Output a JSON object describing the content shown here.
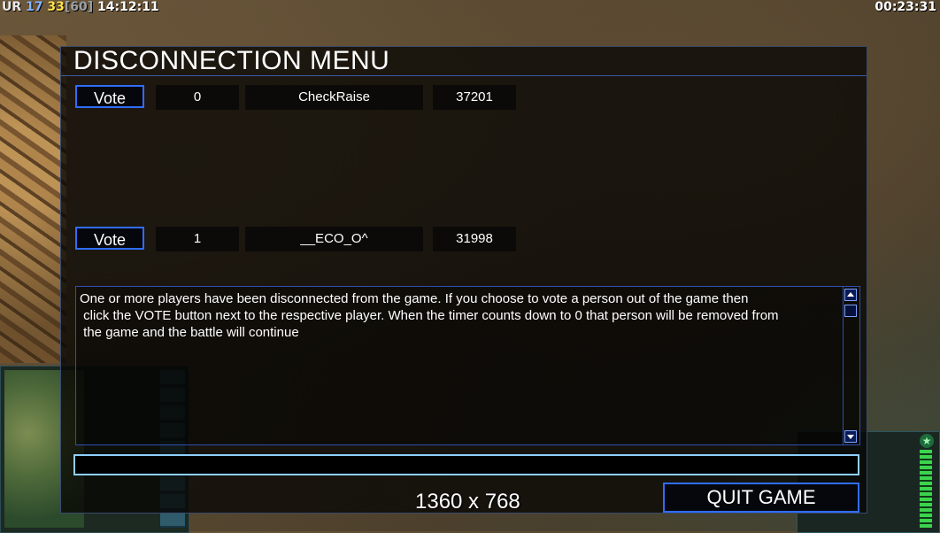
{
  "hud": {
    "rank": "UR",
    "stat_a": "17",
    "stat_b": "33",
    "stat_c": "[60]",
    "clock": "14:12:11",
    "elapsed": "00:23:31"
  },
  "dialog": {
    "title": "DISCONNECTION MENU",
    "players": [
      {
        "vote_label": "Vote",
        "count": "0",
        "name": "CheckRaise",
        "timer": "37201"
      },
      {
        "vote_label": "Vote",
        "count": "1",
        "name": "__ECO_O^",
        "timer": "31998"
      }
    ],
    "message": "One or more players have been disconnected from the game. If you choose to vote a person out of the game then\n click the VOTE button next to the respective player. When the timer counts down to 0 that person will be removed from\n the game and the battle will continue",
    "chat_value": "",
    "resolution": "1360 x 768",
    "quit_label": "QUIT GAME"
  },
  "colors": {
    "accent_border": "#2f6dff",
    "input_border": "#8fd0ff"
  }
}
